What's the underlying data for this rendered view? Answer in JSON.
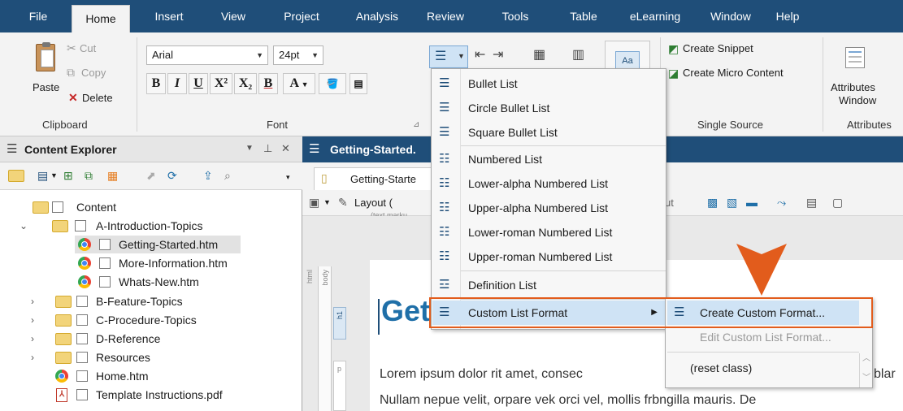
{
  "menubar": {
    "tabs": [
      {
        "label": "File",
        "active": false
      },
      {
        "label": "Home",
        "active": true
      },
      {
        "label": "Insert",
        "active": false
      },
      {
        "label": "View",
        "active": false
      },
      {
        "label": "Project",
        "active": false
      },
      {
        "label": "Analysis",
        "active": false
      },
      {
        "label": "Review",
        "active": false
      },
      {
        "label": "Tools",
        "active": false
      },
      {
        "label": "Table",
        "active": false
      },
      {
        "label": "eLearning",
        "active": false
      },
      {
        "label": "Window",
        "active": false
      },
      {
        "label": "Help",
        "active": false
      }
    ]
  },
  "ribbon": {
    "clipboard": {
      "cut": "Cut",
      "copy": "Copy",
      "paste": "Paste",
      "delete": "Delete",
      "group_label": "Clipboard"
    },
    "font": {
      "font_name": "Arial",
      "font_size": "24pt",
      "group_label": "Font",
      "buttons": [
        "B",
        "I",
        "U",
        "X²",
        "X₂",
        "B",
        "A"
      ]
    },
    "single_source": {
      "create_snippet": "Create Snippet",
      "create_micro_content": "Create Micro Content",
      "group_label": "Single Source"
    },
    "attributes": {
      "window_label_line1": "Attributes",
      "window_label_line2": "Window",
      "group_label": "Attributes"
    }
  },
  "explorer": {
    "title": "Content Explorer",
    "tree": [
      {
        "label": "Content",
        "type": "folder",
        "twisty": ""
      },
      {
        "label": "A-Introduction-Topics",
        "type": "folder",
        "twisty": "⌄"
      },
      {
        "label": "Getting-Started.htm",
        "type": "htm",
        "twisty": ""
      },
      {
        "label": "More-Information.htm",
        "type": "htm",
        "twisty": ""
      },
      {
        "label": "Whats-New.htm",
        "type": "htm",
        "twisty": ""
      },
      {
        "label": "B-Feature-Topics",
        "type": "folder",
        "twisty": "›"
      },
      {
        "label": "C-Procedure-Topics",
        "type": "folder",
        "twisty": "›"
      },
      {
        "label": "D-Reference",
        "type": "folder",
        "twisty": "›"
      },
      {
        "label": "Resources",
        "type": "folder",
        "twisty": "›"
      },
      {
        "label": "Home.htm",
        "type": "htm",
        "twisty": ""
      },
      {
        "label": "Template Instructions.pdf",
        "type": "pdf",
        "twisty": ""
      }
    ]
  },
  "editor": {
    "title": "Getting-Started.",
    "tab": "Getting-Starte",
    "layout_label": "Layout (",
    "text_markup_hint": "(text marku",
    "ruler_html": "html",
    "ruler_body": "body",
    "ruler_h1": "h1",
    "ruler_p": "p",
    "out_label": "ut",
    "heading": "Getting Started",
    "para1_start": "Lorem ipsum dolor rit amet, consec",
    "para1_end": "blar",
    "para2": "Nullam nepue velit, orpare vek orci vel, mollis frbngilla mauris. De"
  },
  "list_menu": {
    "items": [
      {
        "label": "Bullet List",
        "icon": "bullet-list-icon"
      },
      {
        "label": "Circle Bullet List",
        "icon": "circle-bullet-list-icon"
      },
      {
        "label": "Square Bullet List",
        "icon": "square-bullet-list-icon"
      },
      {
        "label": "Numbered List",
        "icon": "numbered-list-icon"
      },
      {
        "label": "Lower-alpha Numbered List",
        "icon": "lower-alpha-list-icon"
      },
      {
        "label": "Upper-alpha Numbered List",
        "icon": "upper-alpha-list-icon"
      },
      {
        "label": "Lower-roman Numbered List",
        "icon": "lower-roman-list-icon"
      },
      {
        "label": "Upper-roman Numbered List",
        "icon": "upper-roman-list-icon"
      },
      {
        "label": "Definition List",
        "icon": "definition-list-icon"
      },
      {
        "label": "Custom List Format",
        "icon": "custom-list-format-icon"
      }
    ]
  },
  "sub_menu": {
    "create": "Create Custom Format...",
    "edit": "Edit Custom List Format...",
    "reset": "(reset class)"
  },
  "colors": {
    "menubar": "#1f4e79",
    "highlight": "#e25c1c",
    "heading": "#1f6fa8"
  }
}
